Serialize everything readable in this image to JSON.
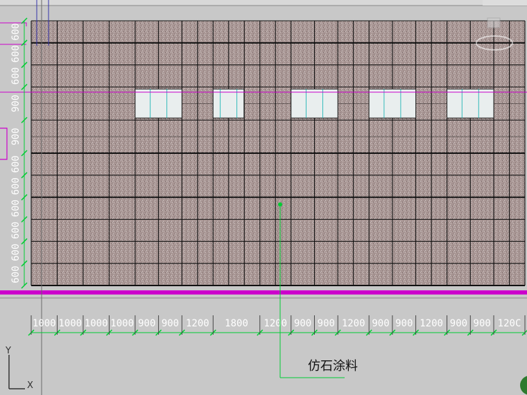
{
  "drawing": {
    "material_label": "仿石涂料",
    "ucs_y": "Y",
    "ucs_x": "X"
  },
  "dimensions": {
    "horizontal": [
      {
        "text": "1000",
        "mm": 1000
      },
      {
        "text": "1000",
        "mm": 1000
      },
      {
        "text": "1000",
        "mm": 1000
      },
      {
        "text": "1000",
        "mm": 1000
      },
      {
        "text": "900",
        "mm": 900
      },
      {
        "text": "900",
        "mm": 900
      },
      {
        "text": "1200",
        "mm": 1200
      },
      {
        "text": "1800",
        "mm": 1800
      },
      {
        "text": "1200",
        "mm": 1200
      },
      {
        "text": "900",
        "mm": 900
      },
      {
        "text": "900",
        "mm": 900
      },
      {
        "text": "1200",
        "mm": 1200
      },
      {
        "text": "900",
        "mm": 900
      },
      {
        "text": "900",
        "mm": 900
      },
      {
        "text": "1200",
        "mm": 1200
      },
      {
        "text": "900",
        "mm": 900
      },
      {
        "text": "900",
        "mm": 900
      },
      {
        "text": "120C",
        "mm": 1200
      }
    ],
    "vertical_top_to_bottom": [
      {
        "text": "600",
        "mm": 600
      },
      {
        "text": "600",
        "mm": 600
      },
      {
        "text": "600",
        "mm": 600
      },
      {
        "text": "900",
        "mm": 900
      },
      {
        "text": "900",
        "mm": 900
      },
      {
        "text": "600",
        "mm": 600
      },
      {
        "text": "600",
        "mm": 600
      },
      {
        "text": "600",
        "mm": 600
      },
      {
        "text": "600",
        "mm": 600
      },
      {
        "text": "600",
        "mm": 600
      },
      {
        "text": "600",
        "mm": 600
      }
    ]
  },
  "colors": {
    "background": "#c8c8c8",
    "stone_fill": "#a89694",
    "grid_line": "#111111",
    "magenta": "#cc00cc",
    "dimension_green": "#00cc33",
    "window_glass": "#e9eeee",
    "window_mullion": "#33bbbb"
  }
}
